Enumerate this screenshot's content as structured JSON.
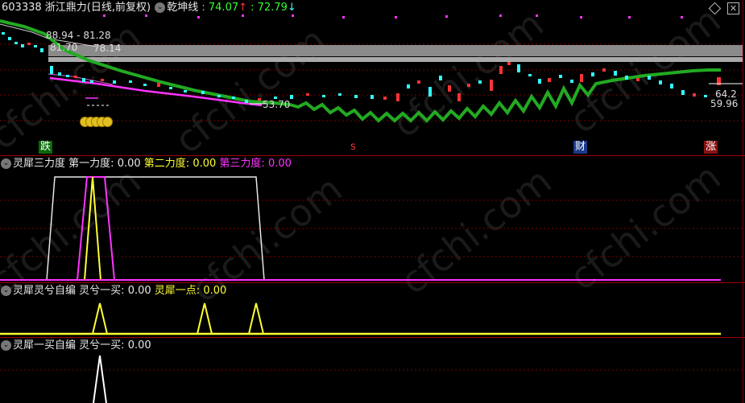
{
  "header": {
    "code": "603338",
    "name": "浙江鼎力",
    "period": "(日线,前复权)",
    "indicator": "乾坤线",
    "val1": "74.07",
    "arrow_up": "↑",
    "val2": "72.79",
    "arrow_down": "↓"
  },
  "price_labels": {
    "hi_range": "88.94 - 81.28",
    "p1": "81.70",
    "p2": "78.14",
    "low": "53.70",
    "r1": "64.2",
    "r2": "59.96"
  },
  "markers": {
    "m_die": "跌",
    "m_s": "s",
    "m_cai": "财",
    "m_zhang": "涨"
  },
  "panel2": {
    "title": "灵犀三力度",
    "f1_label": "第一力度:",
    "f1_value": "0.00",
    "f2_label": "第二力度:",
    "f2_value": "0.00",
    "f3_label": "第三力度:",
    "f3_value": "0.00"
  },
  "panel3": {
    "title": "灵犀灵兮自编",
    "a_label": "灵兮一买:",
    "a_value": "0.00",
    "b_label": "灵犀一点:",
    "b_value": "0.00"
  },
  "panel4": {
    "title": "灵犀一买自编",
    "a_label": "灵兮一买:",
    "a_value": "0.00"
  },
  "watermark": "cfchi.com",
  "colors": {
    "bg": "#000000",
    "separator": "#a00000",
    "up": "#ff3333",
    "down": "#33ffff",
    "trend": "#22aa22",
    "magenta": "#ff33ff",
    "yellow": "#ffff33"
  }
}
